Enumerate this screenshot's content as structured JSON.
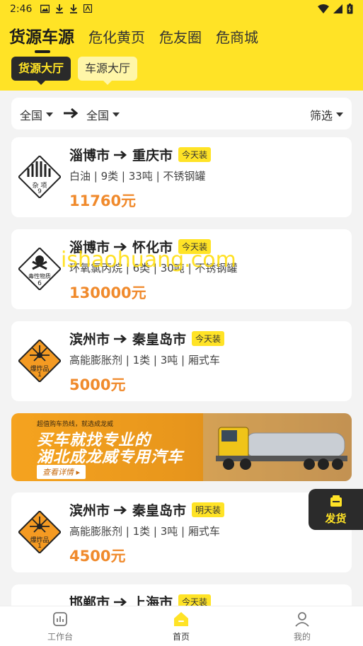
{
  "status_bar": {
    "time": "2:46"
  },
  "tabs": [
    "货源车源",
    "危化黄页",
    "危友圈",
    "危商城"
  ],
  "sub_tabs": {
    "active": "货源大厅",
    "other": "车源大厅"
  },
  "filter": {
    "from": "全国",
    "to": "全国",
    "filter_label": "筛选"
  },
  "cards": [
    {
      "route_from": "淄博市",
      "route_to": "重庆市",
      "tag": "今天装",
      "desc": "白油 | 9类 | 33吨 | 不锈钢罐",
      "price": "11760元",
      "badge_text": "杂 项",
      "badge_num": "9",
      "badge_icon": "misc-hazard-class-9-icon"
    },
    {
      "route_from": "淄博市",
      "route_to": "怀化市",
      "tag": "今天装",
      "desc": "环氧氯丙烷 | 6类 | 30吨 | 不锈钢罐",
      "price": "130000元",
      "badge_text": "毒性物质",
      "badge_num": "6",
      "badge_icon": "toxic-class-6-icon"
    },
    {
      "route_from": "滨州市",
      "route_to": "秦皇岛市",
      "tag": "今天装",
      "desc": "高能膨胀剂 | 1类 | 3吨 | 厢式车",
      "price": "5000元",
      "badge_text": "爆炸品",
      "badge_num": "1",
      "badge_icon": "explosive-class-1-icon"
    },
    {
      "route_from": "滨州市",
      "route_to": "秦皇岛市",
      "tag": "明天装",
      "desc": "高能膨胀剂 | 1类 | 3吨 | 厢式车",
      "price": "4500元",
      "badge_text": "爆炸品",
      "badge_num": "1",
      "badge_icon": "explosive-class-1-icon"
    },
    {
      "route_from": "邯郸市",
      "route_to": "上海市",
      "tag": "今天装"
    }
  ],
  "banner": {
    "small": "超值购车热线，就选成龙威",
    "line1": "买车就找专业的",
    "line2": "湖北成龙威专用汽车",
    "button": "查看详情 ▸"
  },
  "fab": {
    "label": "发货"
  },
  "watermark": "ishaohuang.com",
  "nav": [
    "工作台",
    "首页",
    "我的"
  ],
  "colors": {
    "accent": "#ffe326",
    "price": "#f08a2c",
    "dark": "#2a2a2a"
  }
}
